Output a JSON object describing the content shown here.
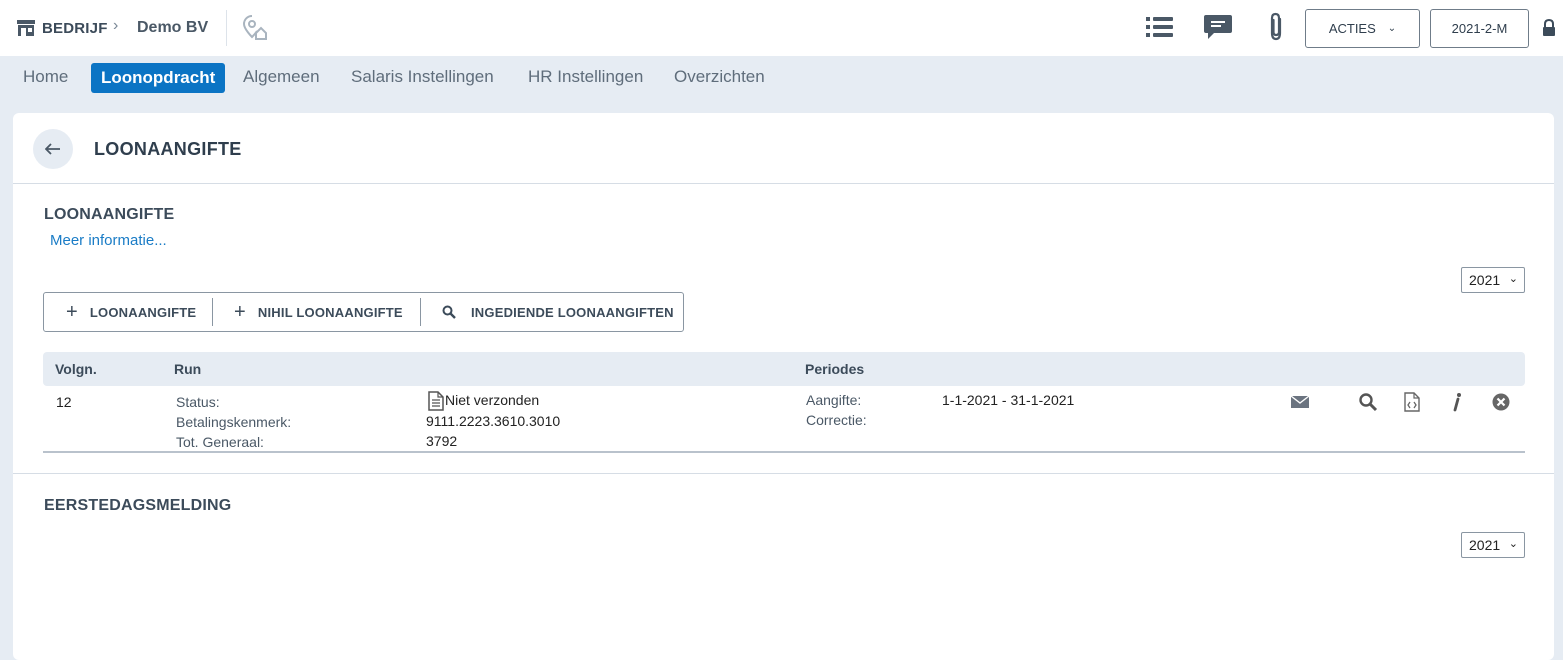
{
  "header": {
    "company_label": "BEDRIJF",
    "company_name": "Demo BV",
    "acties_label": "ACTIES",
    "period_label": "2021-2-M"
  },
  "nav": {
    "items": [
      {
        "label": "Home",
        "active": false
      },
      {
        "label": "Loonopdracht",
        "active": true
      },
      {
        "label": "Algemeen",
        "active": false
      },
      {
        "label": "Salaris Instellingen",
        "active": false
      },
      {
        "label": "HR Instellingen",
        "active": false
      },
      {
        "label": "Overzichten",
        "active": false
      }
    ]
  },
  "page": {
    "title": "LOONAANGIFTE"
  },
  "loonaangifte": {
    "section_title": "LOONAANGIFTE",
    "more_info": "Meer informatie...",
    "year": "2021",
    "buttons": {
      "add": "LOONAANGIFTE",
      "add_nihil": "NIHIL LOONAANGIFTE",
      "submitted": "INGEDIENDE LOONAANGIFTEN"
    },
    "table": {
      "headers": {
        "volgn": "Volgn.",
        "run": "Run",
        "periodes": "Periodes"
      },
      "rows": [
        {
          "volgn": "12",
          "status_label": "Status:",
          "status_value": "Niet verzonden",
          "kenmerk_label": "Betalingskenmerk:",
          "kenmerk_value": "9111.2223.3610.3010",
          "totaal_label": "Tot. Generaal:",
          "totaal_value": "3792",
          "aangifte_label": "Aangifte:",
          "aangifte_value": "1-1-2021 - 31-1-2021",
          "correctie_label": "Correctie:"
        }
      ]
    }
  },
  "eerstedagsmelding": {
    "section_title": "EERSTEDAGSMELDING",
    "year": "2021"
  },
  "colors": {
    "accent": "#0b74c4",
    "background": "#e6ecf3",
    "text": "#2f3e4d",
    "link": "#1a7cc6"
  }
}
